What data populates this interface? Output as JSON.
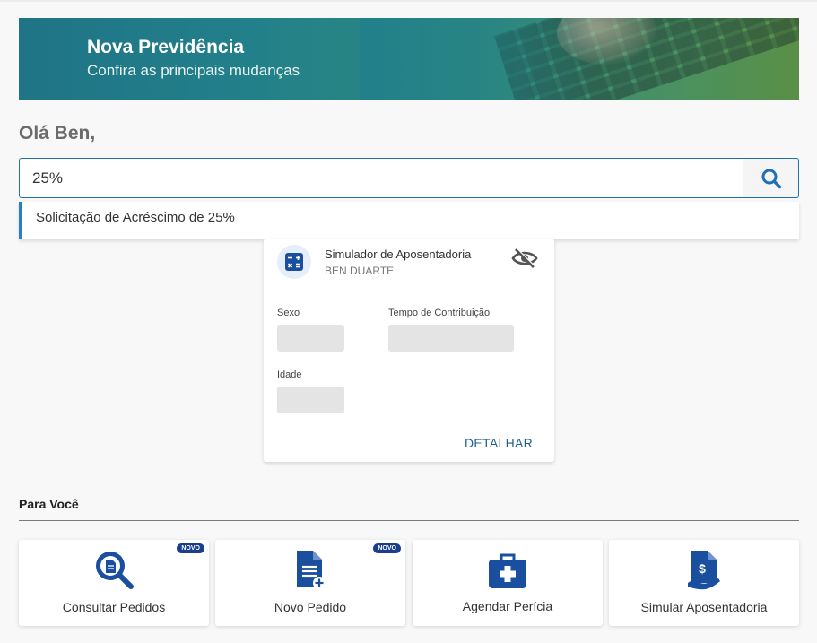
{
  "banner": {
    "title": "Nova Previdência",
    "subtitle": "Confira as principais mudanças"
  },
  "greeting": "Olá Ben,",
  "search": {
    "value": "25%",
    "icon": "search-icon",
    "suggestion": "Solicitação de Acréscimo de 25%"
  },
  "simulator_card": {
    "icon": "calculator-icon",
    "title": "Simulador de Aposentadoria",
    "name": "BEN DUARTE",
    "visibility_icon": "eye-off-icon",
    "fields": {
      "sexo": "Sexo",
      "tempo": "Tempo de Contribuição",
      "idade": "Idade"
    },
    "action": "DETALHAR"
  },
  "para_voce": {
    "title": "Para Você",
    "tiles": [
      {
        "label": "Consultar Pedidos",
        "icon": "search-document-icon",
        "badge": "NOVO"
      },
      {
        "label": "Novo Pedido",
        "icon": "add-document-icon",
        "badge": "NOVO"
      },
      {
        "label": "Agendar Perícia",
        "icon": "medical-kit-icon"
      },
      {
        "label": "Simular Aposentadoria",
        "icon": "retirement-money-icon"
      }
    ]
  },
  "colors": {
    "primary": "#1a4fa0",
    "accent": "#2a7fc1",
    "banner_start": "#1f7486",
    "banner_end": "#5a9046"
  }
}
